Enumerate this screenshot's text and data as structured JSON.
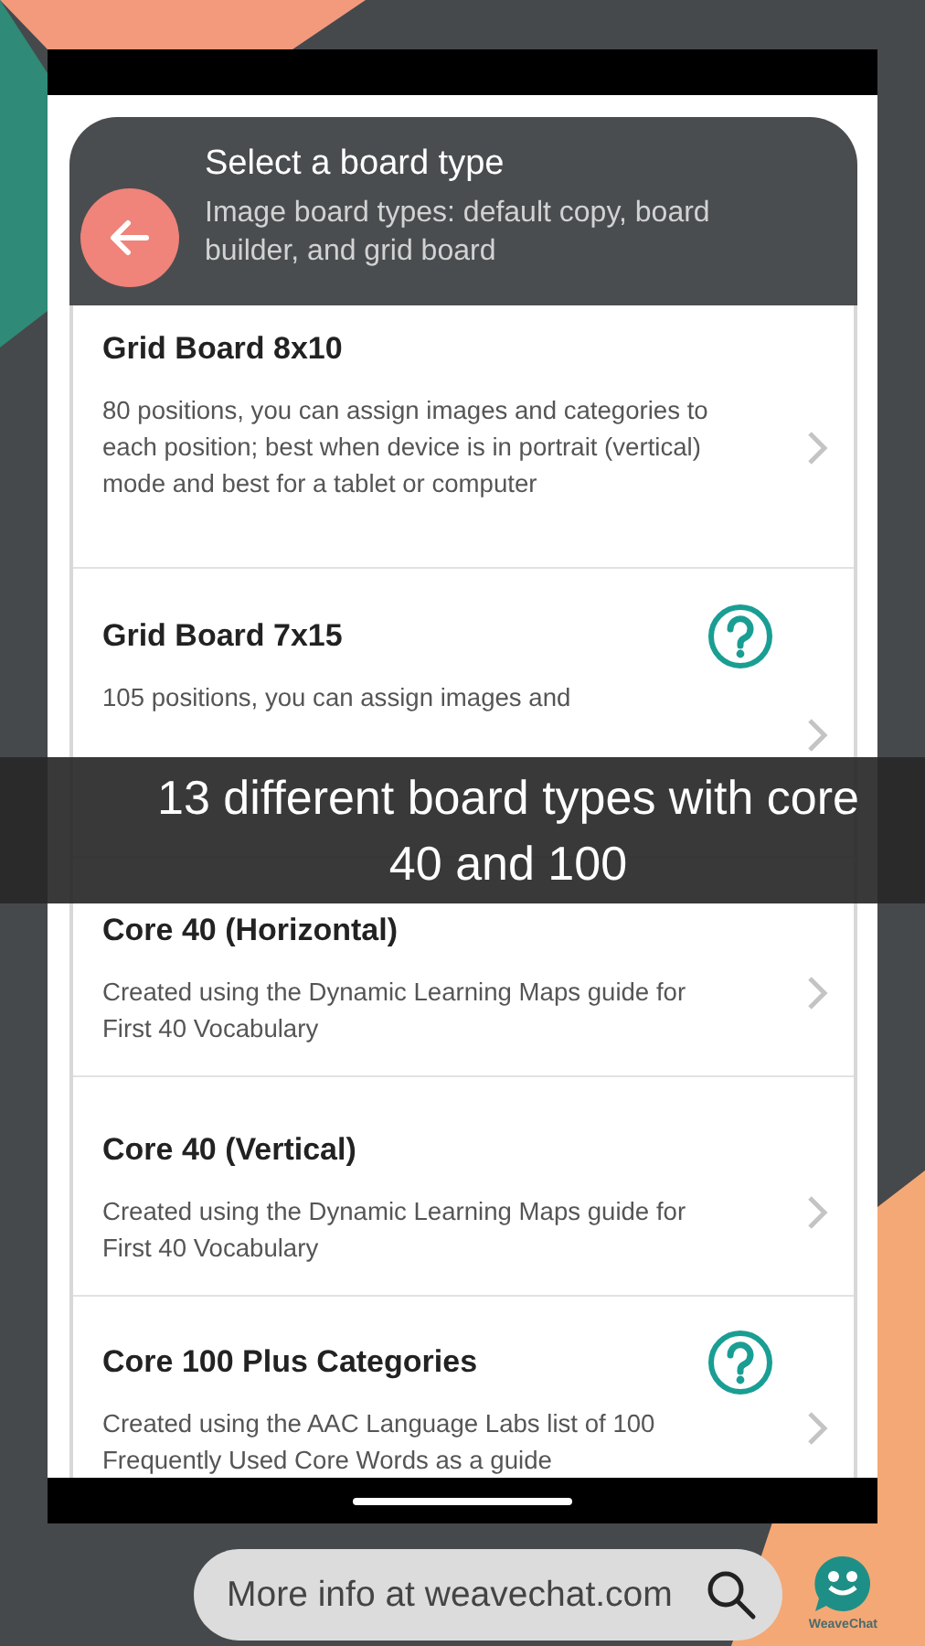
{
  "header": {
    "title": "Select a board type",
    "subtitle": "Image board types: default copy, board builder, and grid board"
  },
  "board_types": [
    {
      "title": "Grid Board 8x10",
      "description": "80 positions, you can assign images and categories to each position; best when device is in portrait (vertical) mode and best for a tablet or computer",
      "help": false
    },
    {
      "title": "Grid Board 7x15",
      "description": "105 positions, you can assign images and",
      "help": true
    },
    {
      "title": "Core 40 (Horizontal)",
      "description": "Created using the Dynamic Learning Maps guide for First 40 Vocabulary",
      "help": false
    },
    {
      "title": "Core 40 (Vertical)",
      "description": "Created using the Dynamic Learning Maps guide for First 40 Vocabulary",
      "help": false
    },
    {
      "title": "Core 100 Plus Categories",
      "description": "Created using the AAC Language Labs list of 100 Frequently Used Core Words as a guide",
      "help": true
    }
  ],
  "banner": {
    "text": "13 different board types with core 40 and 100"
  },
  "footer": {
    "search_text": "More info at weavechat.com",
    "logo_text": "WeaveChat"
  }
}
